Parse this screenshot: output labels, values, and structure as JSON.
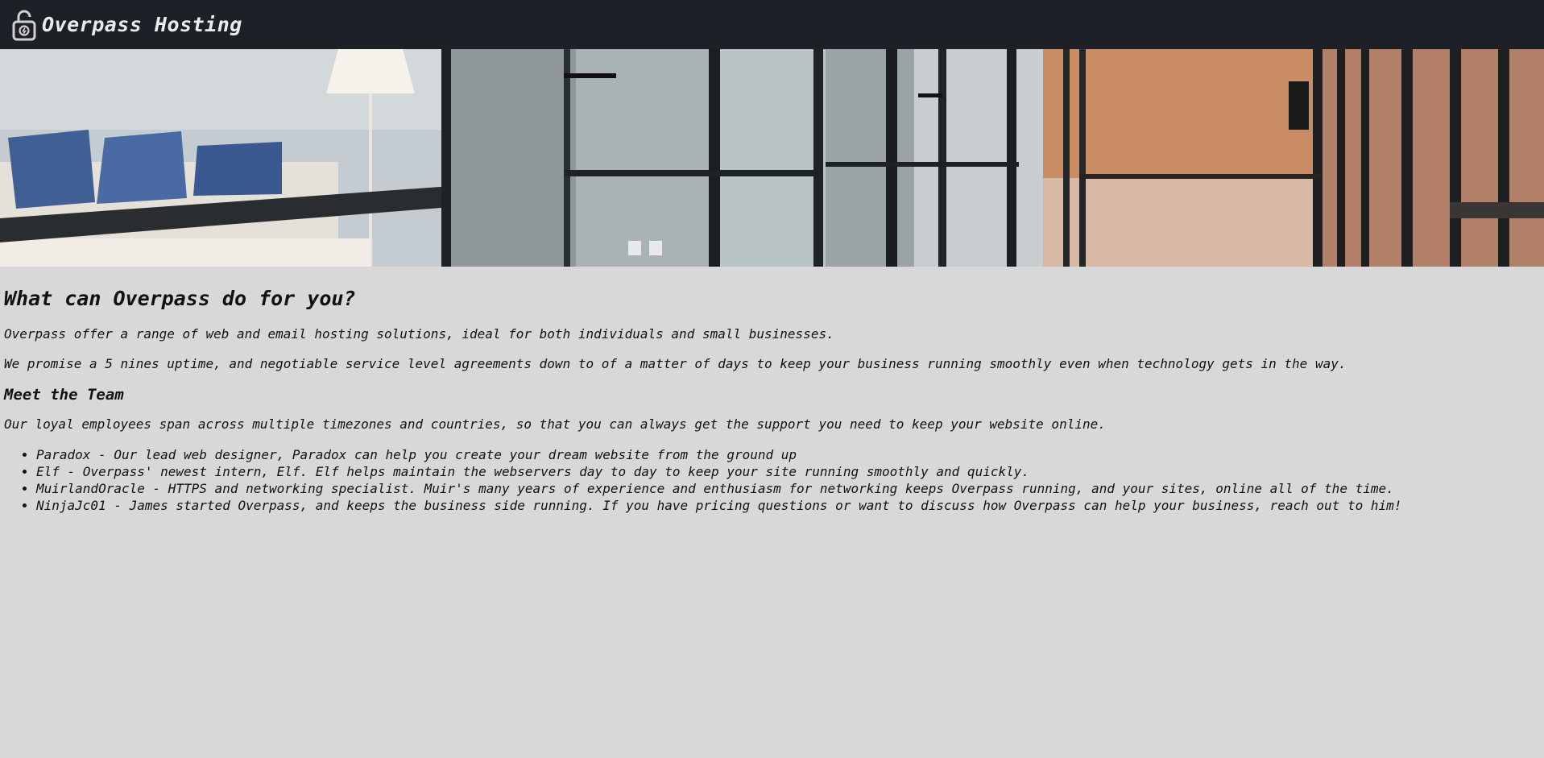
{
  "navbar": {
    "brand_text": "Overpass Hosting",
    "brand_icon": "padlock-icon"
  },
  "banner": {
    "alt": "office hallway photo"
  },
  "main": {
    "heading": "What can Overpass do for you?",
    "intro_1": "Overpass offer a range of web and email hosting solutions, ideal for both individuals and small businesses.",
    "intro_2": "We promise a 5 nines uptime, and negotiable service level agreements down to of a matter of days to keep your business running smoothly even when technology gets in the way.",
    "team_heading": "Meet the Team",
    "team_intro": "Our loyal employees span across multiple timezones and countries, so that you can always get the support you need to keep your website online.",
    "team": [
      "Paradox - Our lead web designer, Paradox can help you create your dream website from the ground up",
      "Elf - Overpass' newest intern, Elf. Elf helps maintain the webservers day to day to keep your site running smoothly and quickly.",
      "MuirlandOracle - HTTPS and networking specialist. Muir's many years of experience and enthusiasm for networking keeps Overpass running, and your sites, online all of the time.",
      "NinjaJc01 - James started Overpass, and keeps the business side running. If you have pricing questions or want to discuss how Overpass can help your business, reach out to him!"
    ]
  },
  "colors": {
    "navbar_bg": "#1e2027",
    "page_bg": "#d8d8d8",
    "brand_text": "#ececec"
  }
}
